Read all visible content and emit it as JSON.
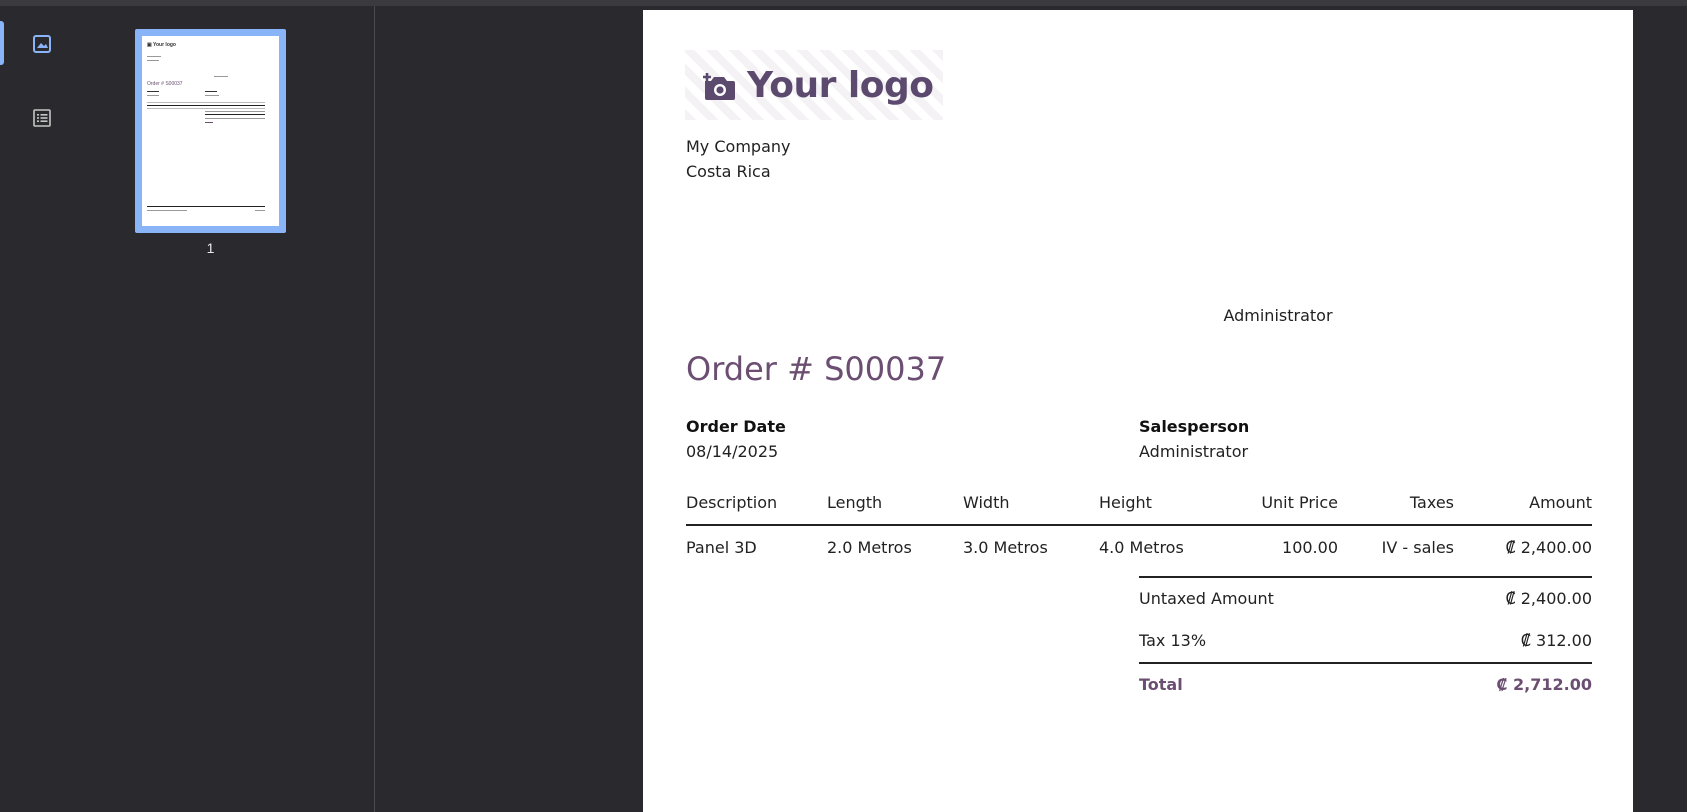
{
  "sidebar": {
    "thumbnails_icon": "image-icon",
    "outline_icon": "list-icon"
  },
  "thumbnails": {
    "page_label": "1"
  },
  "document": {
    "logo_text": "Your logo",
    "company_name": "My Company",
    "company_country": "Costa Rica",
    "header_user": "Administrator",
    "order_title": "Order # S00037",
    "order_date_label": "Order Date",
    "order_date_value": "08/14/2025",
    "salesperson_label": "Salesperson",
    "salesperson_value": "Administrator",
    "table": {
      "headers": [
        "Description",
        "Length",
        "Width",
        "Height",
        "Unit Price",
        "Taxes",
        "Amount"
      ],
      "rows": [
        [
          "Panel 3D",
          "2.0 Metros",
          "3.0 Metros",
          "4.0 Metros",
          "100.00",
          "IV - sales",
          "₡ 2,400.00"
        ]
      ]
    },
    "totals": {
      "untaxed_label": "Untaxed Amount",
      "untaxed_value": "₡ 2,400.00",
      "tax_label": "Tax 13%",
      "tax_value": "₡ 312.00",
      "total_label": "Total",
      "total_value": "₡ 2,712.00"
    }
  },
  "colors": {
    "accent": "#6b4e72",
    "selection": "#8ab4f8",
    "background": "#2a2a2e"
  }
}
